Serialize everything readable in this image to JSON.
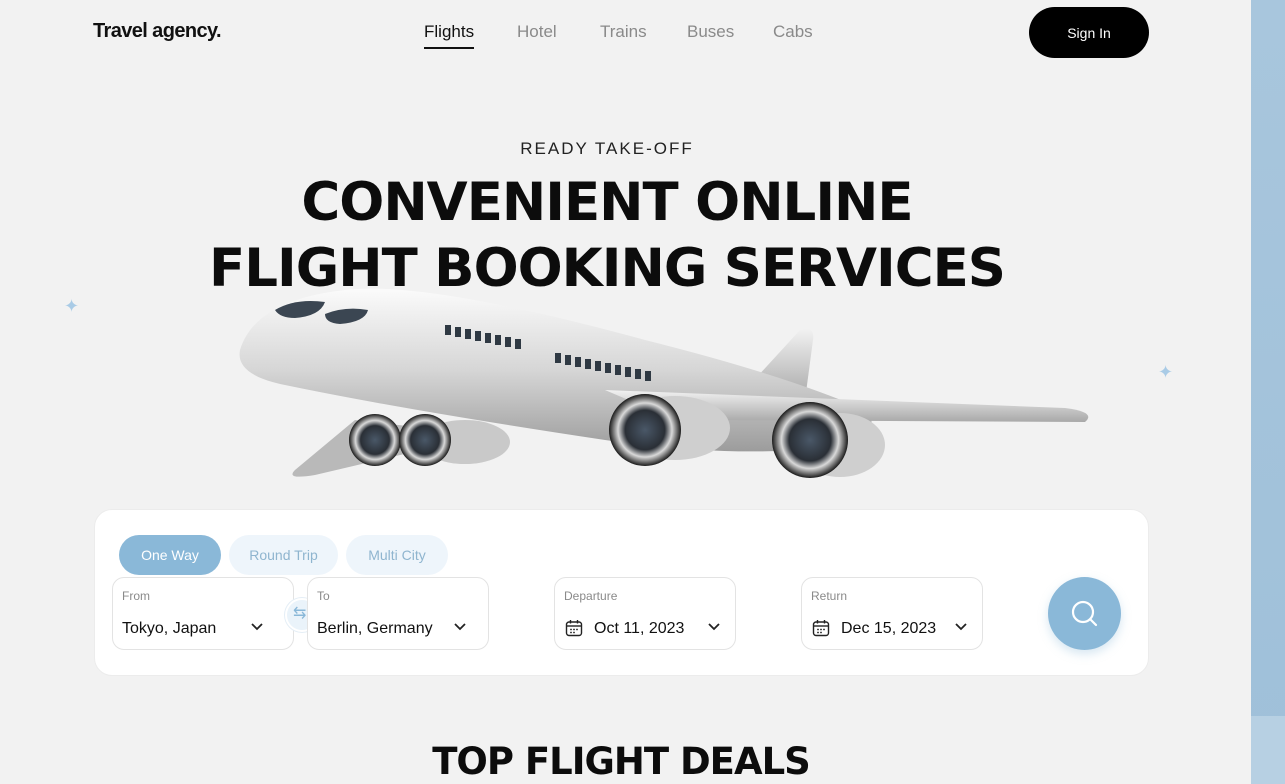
{
  "header": {
    "logo": "Travel agency.",
    "nav": [
      "Flights",
      "Hotel",
      "Trains",
      "Buses",
      "Cabs"
    ],
    "active_nav": "Flights",
    "signin_label": "Sign In"
  },
  "hero": {
    "eyebrow": "READY TAKE-OFF",
    "headline_line1": "CONVENIENT ONLINE",
    "headline_line2": "FLIGHT BOOKING SERVICES"
  },
  "search": {
    "trip_types": [
      "One Way",
      "Round Trip",
      "Multi City"
    ],
    "selected_trip": "One Way",
    "from": {
      "label": "From",
      "value": "Tokyo, Japan"
    },
    "to": {
      "label": "To",
      "value": "Berlin, Germany"
    },
    "departure": {
      "label": "Departure",
      "value": "Oct 11, 2023"
    },
    "return": {
      "label": "Return",
      "value": "Dec 15, 2023"
    },
    "accent_color": "#8ab8d8"
  },
  "deals": {
    "title": "TOP FLIGHT DEALS"
  },
  "icons": [
    "swap-icon",
    "calendar-icon",
    "chevron-down-icon",
    "search-icon",
    "sparkle-icon",
    "airplane-illustration"
  ]
}
